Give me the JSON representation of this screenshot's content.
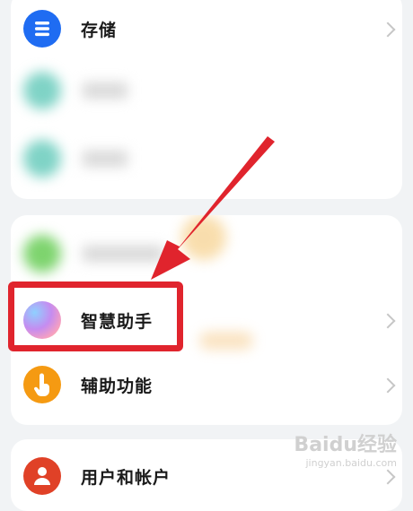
{
  "settings": {
    "items": [
      {
        "label": "存储",
        "icon": "storage-icon",
        "color": "#1f6cf2"
      },
      {
        "label": "智慧助手",
        "icon": "smart-assistant-icon",
        "color": "#c46ee0"
      },
      {
        "label": "辅助功能",
        "icon": "accessibility-hand-icon",
        "color": "#f59a12"
      },
      {
        "label": "用户和帐户",
        "icon": "user-accounts-icon",
        "color": "#e04127"
      }
    ]
  },
  "annotation": {
    "highlight_color": "#e0242d",
    "arrow_color": "#e0242d"
  },
  "watermark": {
    "brand": "Baidu经验",
    "url": "jingyan.baidu.com"
  }
}
